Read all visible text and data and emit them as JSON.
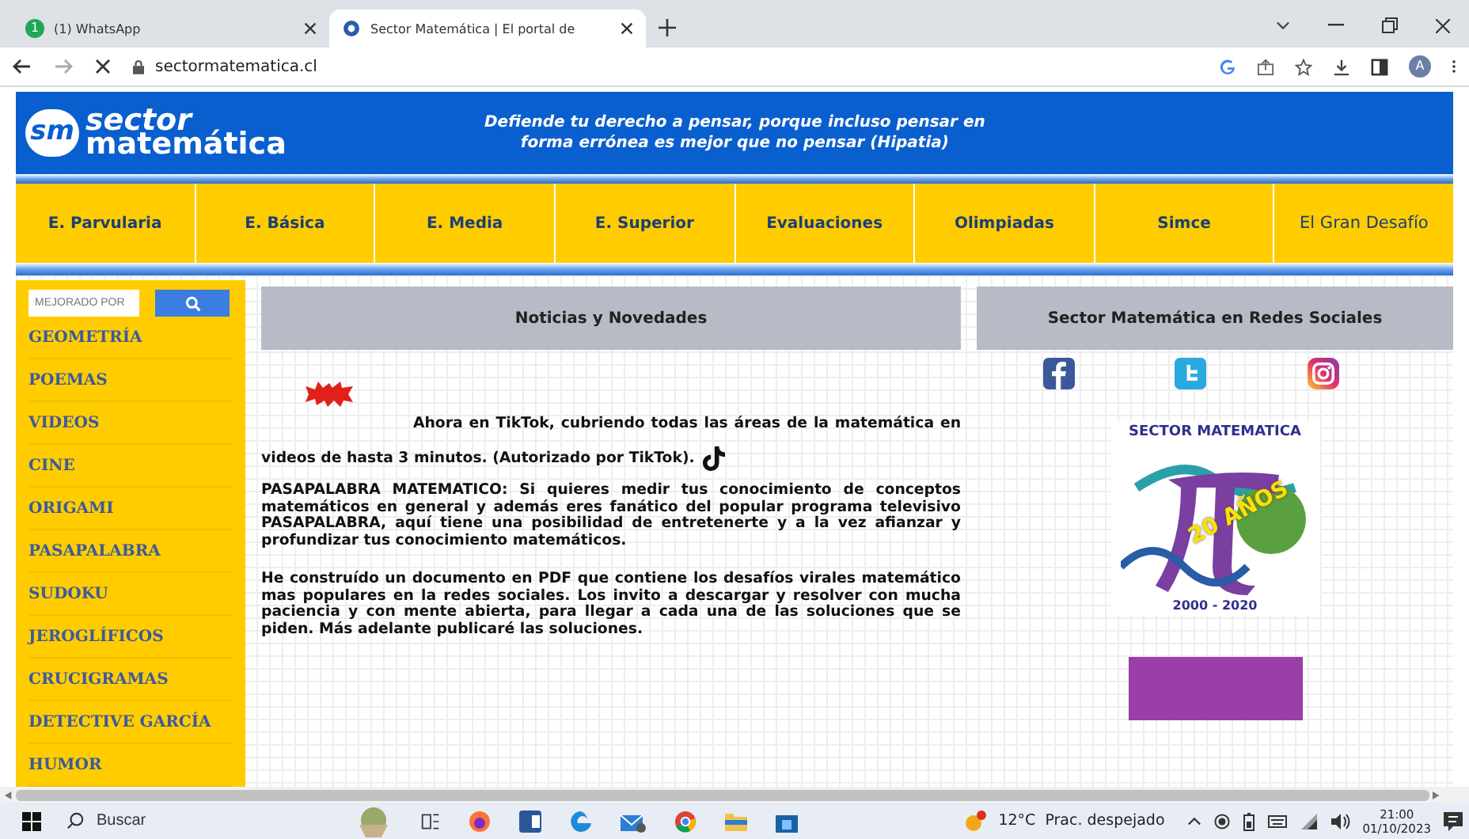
{
  "browser": {
    "tabs": [
      {
        "title": "(1) WhatsApp",
        "badge": "1",
        "selected": false
      },
      {
        "title": "Sector Matemática | El portal de",
        "selected": true
      }
    ],
    "address": "sectormatematica.cl",
    "profile_initial": "A"
  },
  "header": {
    "logo_line1": "sector",
    "logo_line2": "matemática",
    "logo_mark": "sm",
    "quote_line1": "Defiende tu derecho a pensar, porque incluso pensar en",
    "quote_line2": "forma errónea es mejor que no pensar (Hipatia)"
  },
  "nav": [
    {
      "label": "E. Parvularia",
      "kind": "bold"
    },
    {
      "label": "E. Básica",
      "kind": "bold"
    },
    {
      "label": "E. Media",
      "kind": "bold"
    },
    {
      "label": "E. Superior",
      "kind": "bold"
    },
    {
      "label": "Evaluaciones",
      "kind": "bold"
    },
    {
      "label": "Olimpiadas",
      "kind": "bold"
    },
    {
      "label": "Simce",
      "kind": "bold"
    },
    {
      "label": "El Gran Desafío",
      "kind": "plain"
    }
  ],
  "sidebar": {
    "search": {
      "placeholder": "MEJORADO POR"
    },
    "items": [
      "GEOMETRÍA",
      "POEMAS",
      "VIDEOS",
      "CINE",
      "ORIGAMI",
      "PASAPALABRA",
      "SUDOKU",
      "JEROGLÍFICOS",
      "CRUCIGRAMAS",
      "DETECTIVE GARCÍA",
      "HUMOR"
    ]
  },
  "news": {
    "title": "Noticias y Novedades",
    "paragraphs": [
      {
        "kind": "tiktok",
        "text": "Ahora en TikTok, cubriendo todas las áreas de la matemática en videos de hasta 3 minutos. (Autorizado por TikTok)."
      },
      {
        "kind": "plain",
        "text": "PASAPALABRA MATEMATICO: Si quieres medir tus conocimiento de conceptos matemáticos en general y además eres fanático del popular programa televisivo PASAPALABRA, aquí tiene una posibilidad de entretenerte y a la vez afianzar y profundizar tus conocimiento matemáticos."
      },
      {
        "kind": "plain",
        "text": "He construído un documento en PDF que contiene los desafíos virales matemático mas populares en la redes sociales. Los invito a descargar y resolver con mucha paciencia y con mente abierta, para llegar a cada una de las soluciones que se piden. Más adelante publicaré las soluciones."
      }
    ]
  },
  "social": {
    "title": "Sector Matemática en Redes Sociales",
    "anniversary": {
      "title": "SECTOR MATEMATICA",
      "badge": "20 AÑOS",
      "years": "2000 - 2020"
    }
  },
  "taskbar": {
    "search_placeholder": "Buscar",
    "weather": "12°C  Prac. despejado",
    "time": "21:00",
    "date": "01/10/2023"
  }
}
